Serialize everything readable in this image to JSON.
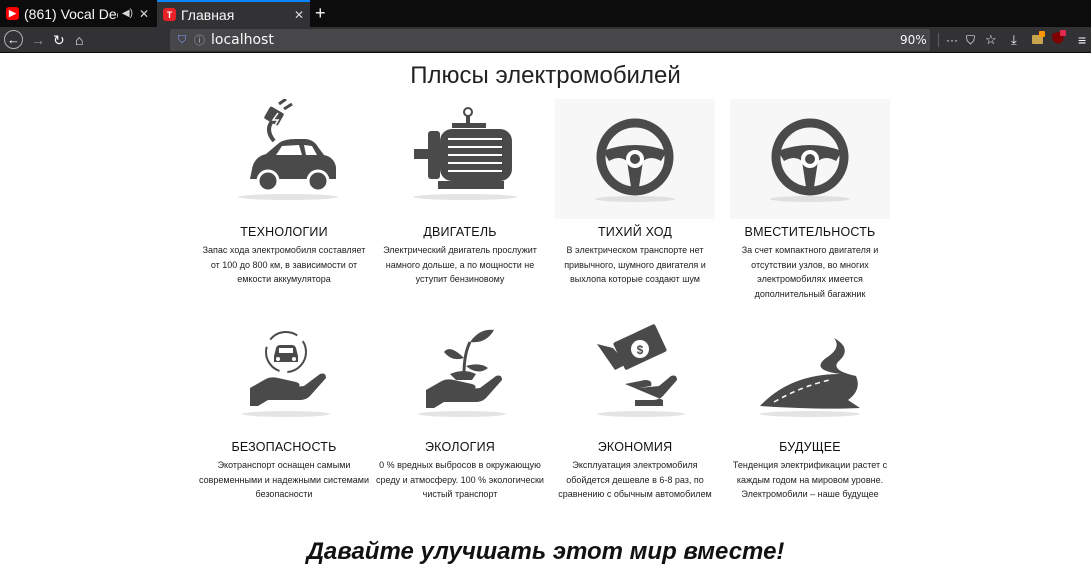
{
  "browser": {
    "tabs": [
      {
        "title": "(861) Vocal Dee",
        "favicon": "youtube-icon",
        "favicon_color": "#ff0000",
        "playing": true,
        "active": false
      },
      {
        "title": "Главная",
        "favicon": "tesla-icon",
        "favicon_color": "#e82127",
        "active": true
      }
    ],
    "url": "localhost",
    "zoom": "90%"
  },
  "page": {
    "title": "Плюсы электромобилей",
    "features": [
      {
        "title": "ТЕХНОЛОГИИ",
        "icon": "electric-car-plug-icon",
        "text": "Запас хода электромобиля составляет от 100 до 800 км, в зависимости от емкости аккумулятора"
      },
      {
        "title": "ДВИГАТЕЛЬ",
        "icon": "electric-motor-icon",
        "text": "Электрический двигатель прослужит намного дольше, а по мощности не уступит бензиновому"
      },
      {
        "title": "ТИХИЙ ХОД",
        "icon": "steering-wheel-icon",
        "text": "В электрическом транспорте нет привычного, шумного двигателя и выхлопа которые создают шум"
      },
      {
        "title": "ВМЕСТИТЕЛЬНОСТЬ",
        "icon": "steering-wheel-icon",
        "text": "За счет компактного двигателя и отсутствии узлов, во многих электромобилях имеется дополнительный багажник"
      },
      {
        "title": "БЕЗОПАСНОСТЬ",
        "icon": "hand-car-safety-icon",
        "text": "Экотранспорт оснащен самыми современными и надежными системами безопасности"
      },
      {
        "title": "ЭКОЛОГИЯ",
        "icon": "hand-plant-icon",
        "text": "0 % вредных выбросов в окружающую среду и атмосферу. 100 % экологически чистый транспорт"
      },
      {
        "title": "ЭКОНОМИЯ",
        "icon": "hand-money-icon",
        "text": "Эксплуатация электромобиля обойдется дешевле в 6-8 раз, по сравнению с обычным автомобилем"
      },
      {
        "title": "БУДУЩЕЕ",
        "icon": "winding-road-icon",
        "text": "Тенденция электрификации растет с каждым годом на мировом уровне. Электромобили – наше будущее"
      }
    ],
    "slogan": "Давайте улучшать этот мир вместе!"
  },
  "colors": {
    "icon": "#4a4a4a",
    "accent": "#0a84ff"
  }
}
